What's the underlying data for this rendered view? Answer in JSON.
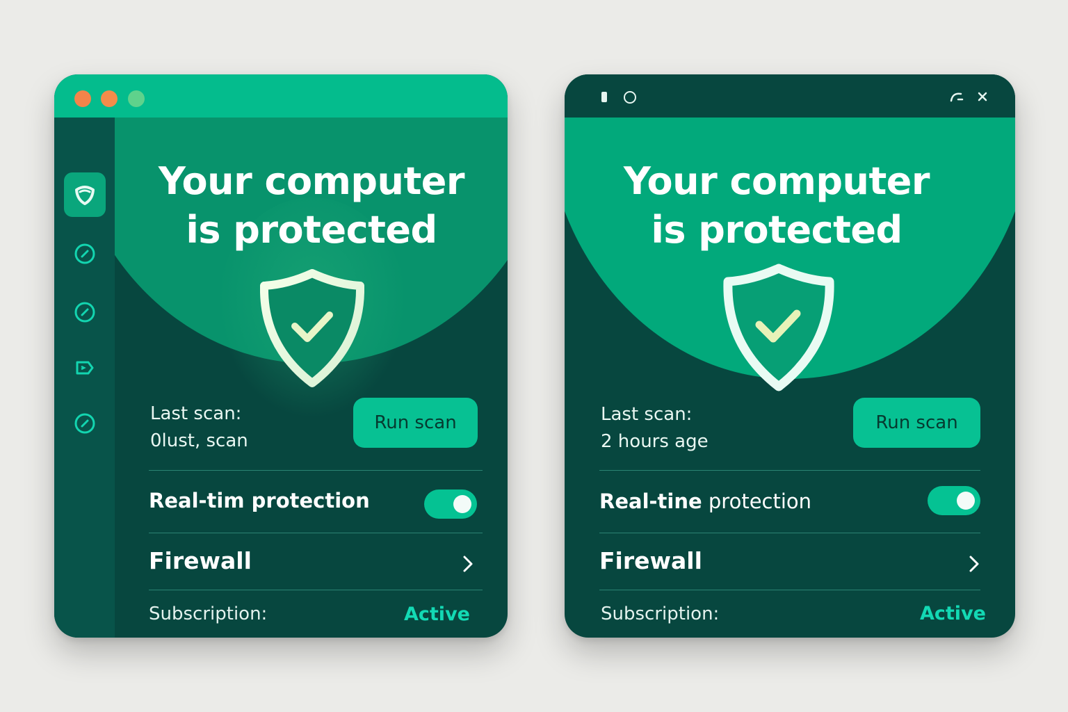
{
  "colors": {
    "accent": "#04bc8d",
    "background_dark": "#07473f",
    "sidebar": "#08544a",
    "status_active": "#13d9b4"
  },
  "windows": [
    {
      "title": "Your computer is protected",
      "title_line1": "Your computer",
      "title_line2": "is protected",
      "scan": {
        "label": "Last scan:",
        "value": "0lust, scan",
        "button_label": "Run scan"
      },
      "realtime": {
        "label": "Real-tim protection",
        "toggle_on": true
      },
      "firewall": {
        "label": "Firewall"
      },
      "subscription": {
        "label": "Subscription:",
        "value": "Active"
      },
      "sidebar_icons": [
        "shield-icon",
        "gauge-icon",
        "gauge-icon",
        "tag-icon",
        "gauge-icon"
      ]
    },
    {
      "title": "Your computer is protected",
      "title_line1": "Your computer",
      "title_line2": "is protected",
      "scan": {
        "label": "Last scan:",
        "value": "2 hours age",
        "button_label": "Run scan"
      },
      "realtime": {
        "label_bold": "Real-tine",
        "label_light": " protection",
        "toggle_on": true
      },
      "firewall": {
        "label": "Firewall"
      },
      "subscription": {
        "label": "Subscription:",
        "value": "Active"
      }
    }
  ]
}
